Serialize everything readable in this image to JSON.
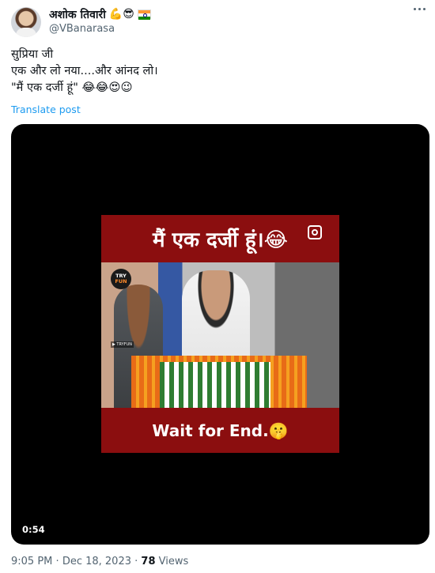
{
  "author": {
    "display_name": "अशोक तिवारी",
    "name_emojis": "💪😎",
    "flag": "india-flag",
    "handle": "@VBanarasa",
    "avatar": "avatar-photo"
  },
  "tweet": {
    "lines": "सुप्रिया जी\nएक और लो नया....और आंनद लो।\n\"मैं एक दर्जी हूं\" 😂😂😍😉",
    "translate_label": "Translate post"
  },
  "video": {
    "caption_top": "मैं एक दर्जी हूं।😂",
    "caption_bottom": "Wait for End.🤫",
    "logo_top": "TRY",
    "logo_bottom": "FUN",
    "yt_tag": "▶ TRYFUN",
    "duration": "0:54",
    "colors": {
      "frame": "#8b0e0f",
      "background": "#000000"
    }
  },
  "meta": {
    "time": "9:05 PM",
    "separator": "·",
    "date": "Dec 18, 2023",
    "views_count": "78",
    "views_label": "Views"
  }
}
